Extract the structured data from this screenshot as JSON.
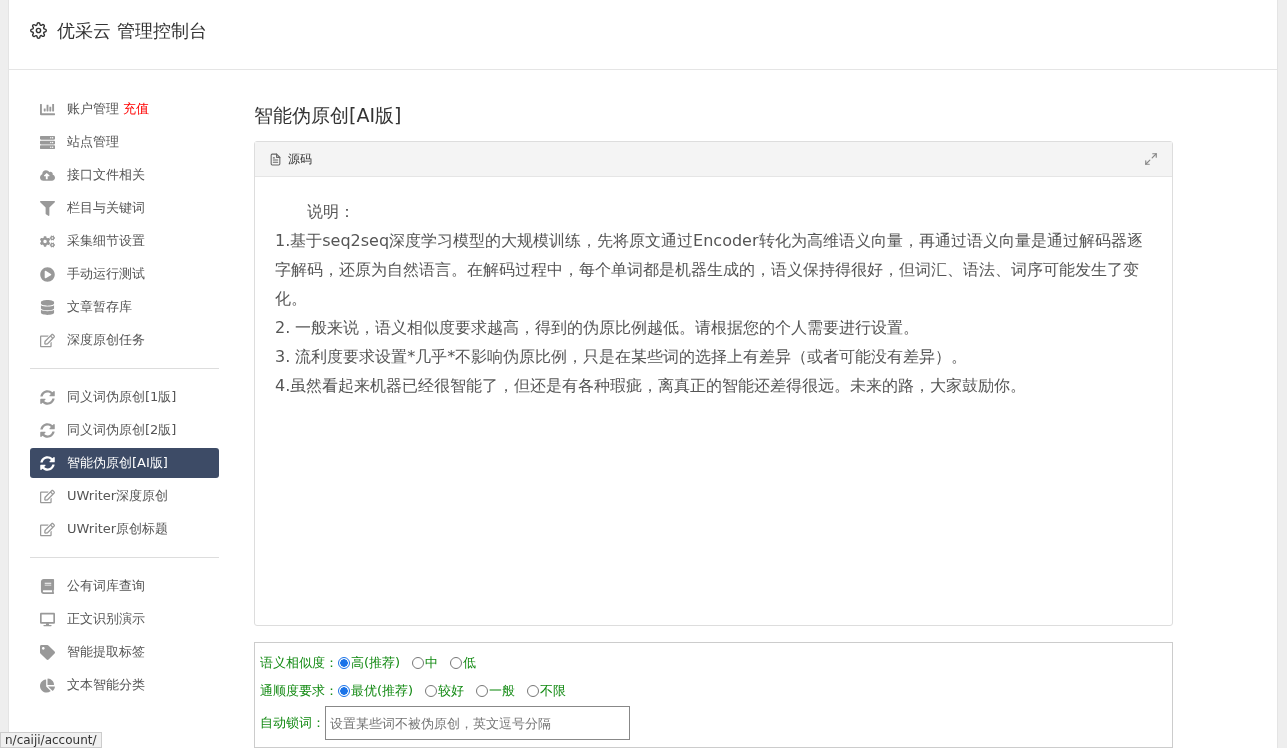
{
  "header": {
    "title": "优采云 管理控制台"
  },
  "sidebar": {
    "groups": [
      {
        "items": [
          {
            "label": "账户管理",
            "badge": "充值",
            "selected": false
          },
          {
            "label": "站点管理",
            "selected": false
          },
          {
            "label": "接口文件相关",
            "selected": false
          },
          {
            "label": "栏目与关键词",
            "selected": false
          },
          {
            "label": "采集细节设置",
            "selected": false
          },
          {
            "label": "手动运行测试",
            "selected": false
          },
          {
            "label": "文章暂存库",
            "selected": false
          },
          {
            "label": "深度原创任务",
            "selected": false
          }
        ]
      },
      {
        "items": [
          {
            "label": "同义词伪原创[1版]",
            "selected": false
          },
          {
            "label": "同义词伪原创[2版]",
            "selected": false
          },
          {
            "label": "智能伪原创[AI版]",
            "selected": true
          },
          {
            "label": "UWriter深度原创",
            "selected": false
          },
          {
            "label": "UWriter原创标题",
            "selected": false
          }
        ]
      },
      {
        "items": [
          {
            "label": "公有词库查询",
            "selected": false
          },
          {
            "label": "正文识别演示",
            "selected": false
          },
          {
            "label": "智能提取标签",
            "selected": false
          },
          {
            "label": "文本智能分类",
            "selected": false
          }
        ]
      }
    ]
  },
  "main": {
    "title": "智能伪原创[AI版]",
    "editor": {
      "tab": "源码",
      "lines": [
        "说明：",
        "1.基于seq2seq深度学习模型的大规模训练，先将原文通过Encoder转化为高维语义向量，再通过语义向量是通过解码器逐字解码，还原为自然语言。在解码过程中，每个单词都是机器生成的，语义保持得很好，但词汇、语法、词序可能发生了变化。",
        "2. 一般来说，语义相似度要求越高，得到的伪原比例越低。请根据您的个人需要进行设置。",
        "3. 流利度要求设置*几乎*不影响伪原比例，只是在某些词的选择上有差异（或者可能没有差异）。",
        "4.虽然看起来机器已经很智能了，但还是有各种瑕疵，离真正的智能还差得很远。未来的路，大家鼓励你。"
      ]
    },
    "form": {
      "options": [
        {
          "label": "语义相似度：",
          "choices": [
            {
              "label": "高(推荐)",
              "selected": true
            },
            {
              "label": "中",
              "selected": false
            },
            {
              "label": "低",
              "selected": false
            }
          ]
        },
        {
          "label": "通顺度要求：",
          "choices": [
            {
              "label": "最优(推荐)",
              "selected": true
            },
            {
              "label": "较好",
              "selected": false
            },
            {
              "label": "一般",
              "selected": false
            },
            {
              "label": "不限",
              "selected": false
            }
          ]
        }
      ],
      "lock": {
        "label": "自动锁词：",
        "placeholder": "设置某些词不被伪原创，英文逗号分隔"
      }
    }
  },
  "status_url": "n/caiji/account/"
}
